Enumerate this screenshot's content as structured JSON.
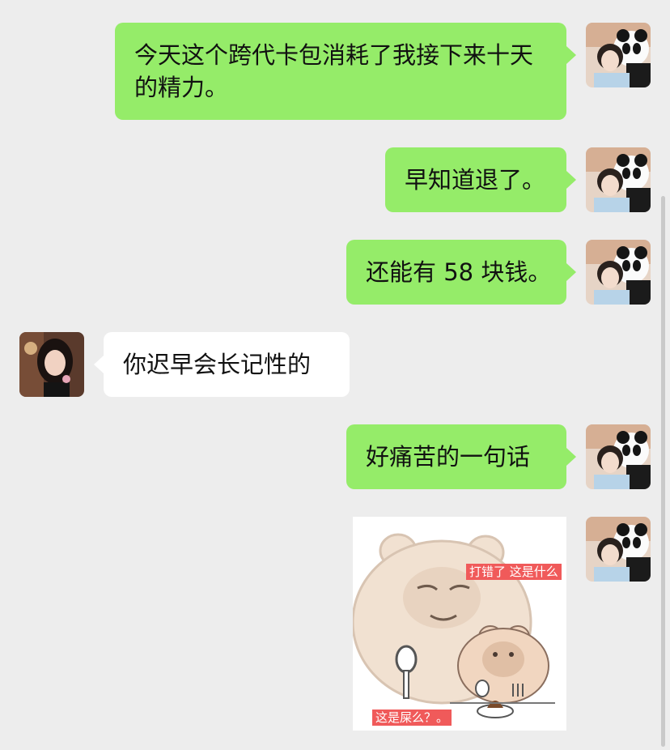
{
  "messages": [
    {
      "from": "me",
      "text": "今天这个跨代卡包消耗了我接下来十天的精力。"
    },
    {
      "from": "me",
      "text": "早知道退了。"
    },
    {
      "from": "me",
      "text": "还能有 58 块钱。"
    },
    {
      "from": "other",
      "text": "你迟早会长记性的"
    },
    {
      "from": "me",
      "text": "好痛苦的一句话"
    }
  ],
  "sticker": {
    "caption_top": "打错了 这是什么",
    "caption_bottom": "这是屎么？。"
  },
  "colors": {
    "bg": "#ededed",
    "my_bubble": "#95ec69",
    "other_bubble": "#ffffff",
    "sticker_tag": "#f05a5a"
  },
  "icons": {
    "my_avatar": "avatar-girl-with-panda",
    "other_avatar": "avatar-woman-portrait"
  }
}
